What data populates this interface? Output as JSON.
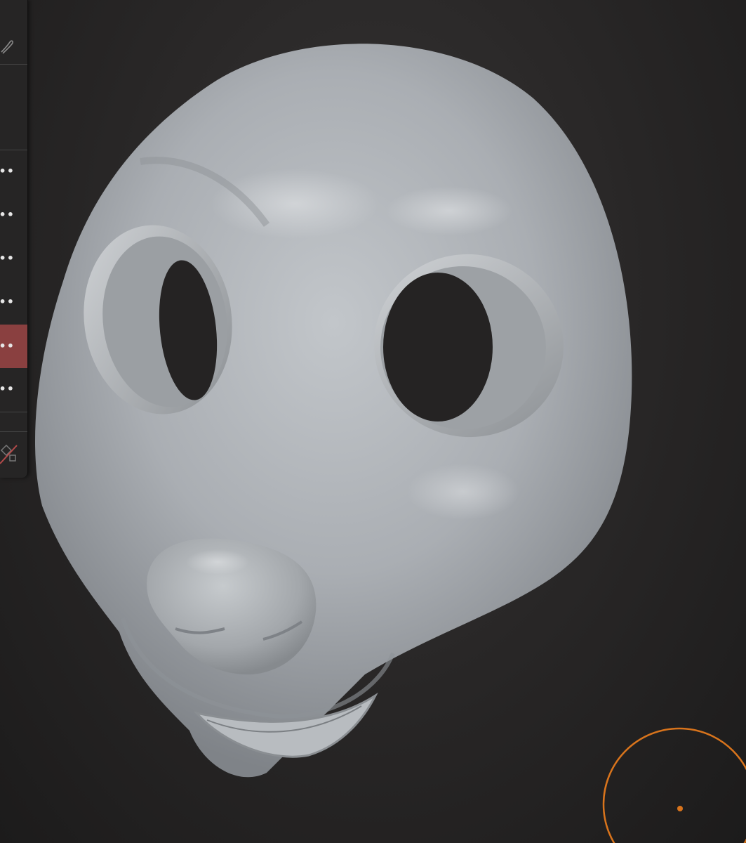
{
  "app": {
    "accent_color": "#d9741c",
    "active_layer_color": "#8a4040",
    "panel_color": "#262525"
  },
  "layers_panel": {
    "top_icon": "brush-link-icon",
    "bottom_icon": "visibility-off-icon",
    "items": [
      {
        "label": "•••",
        "active": false
      },
      {
        "label": "•••",
        "active": false
      },
      {
        "label": "•••",
        "active": false
      },
      {
        "label": "•••",
        "active": false
      },
      {
        "label": "•••",
        "active": true
      },
      {
        "label": "•••",
        "active": false
      }
    ]
  },
  "viewport": {
    "model": "sculpted-mask-head",
    "brush_cursor": "circle-brush-cursor"
  }
}
